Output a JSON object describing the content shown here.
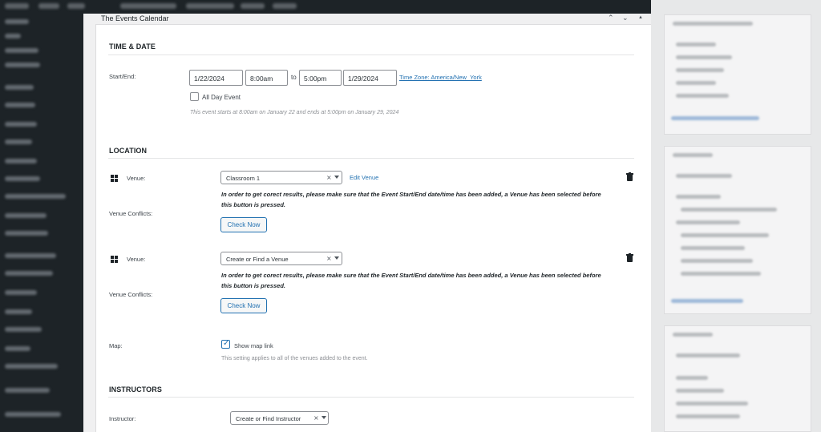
{
  "panel": {
    "title": "The Events Calendar",
    "icons": [
      "chevron-up-icon",
      "chevron-down-icon",
      "collapse-arrow-icon"
    ]
  },
  "time_date": {
    "section_title": "TIME & DATE",
    "start_end_label": "Start/End:",
    "start_date": "1/22/2024",
    "start_time": "8:00am",
    "to_label": "to",
    "end_time": "5:00pm",
    "end_date": "1/29/2024",
    "timezone_link": "Time Zone: America/New_York",
    "all_day_label": "All Day Event",
    "all_day_checked": false,
    "summary": "This event starts at 8:00am on January 22 and ends at 5:00pm on January 29, 2024"
  },
  "location": {
    "section_title": "LOCATION",
    "venues": [
      {
        "venue_label": "Venue:",
        "selected": "Classroom 1",
        "edit_link": "Edit Venue",
        "conflicts_label": "Venue Conflicts:",
        "warning_line1": "In order to get corect results, please make sure that the Event Start/End date/time has been added, a Venue has been selected before",
        "warning_line2": "this button is pressed.",
        "button": "Check Now"
      },
      {
        "venue_label": "Venue:",
        "selected": "Create or Find a Venue",
        "conflicts_label": "Venue Conflicts:",
        "warning_line1": "In order to get corect results, please make sure that the Event Start/End date/time has been added, a Venue has been selected before",
        "warning_line2": "this button is pressed.",
        "button": "Check Now"
      }
    ],
    "map_label": "Map:",
    "show_map_link_label": "Show map link",
    "show_map_link_checked": true,
    "map_note": "This setting applies to all of the venues added to the event."
  },
  "instructors": {
    "section_title": "INSTRUCTORS",
    "instructor_label": "Instructor:",
    "selected": "Create or Find Instructor"
  },
  "colors": {
    "accent": "#2271b1",
    "admin_dark": "#1d2327",
    "panel_bg": "#f0f0f1"
  }
}
